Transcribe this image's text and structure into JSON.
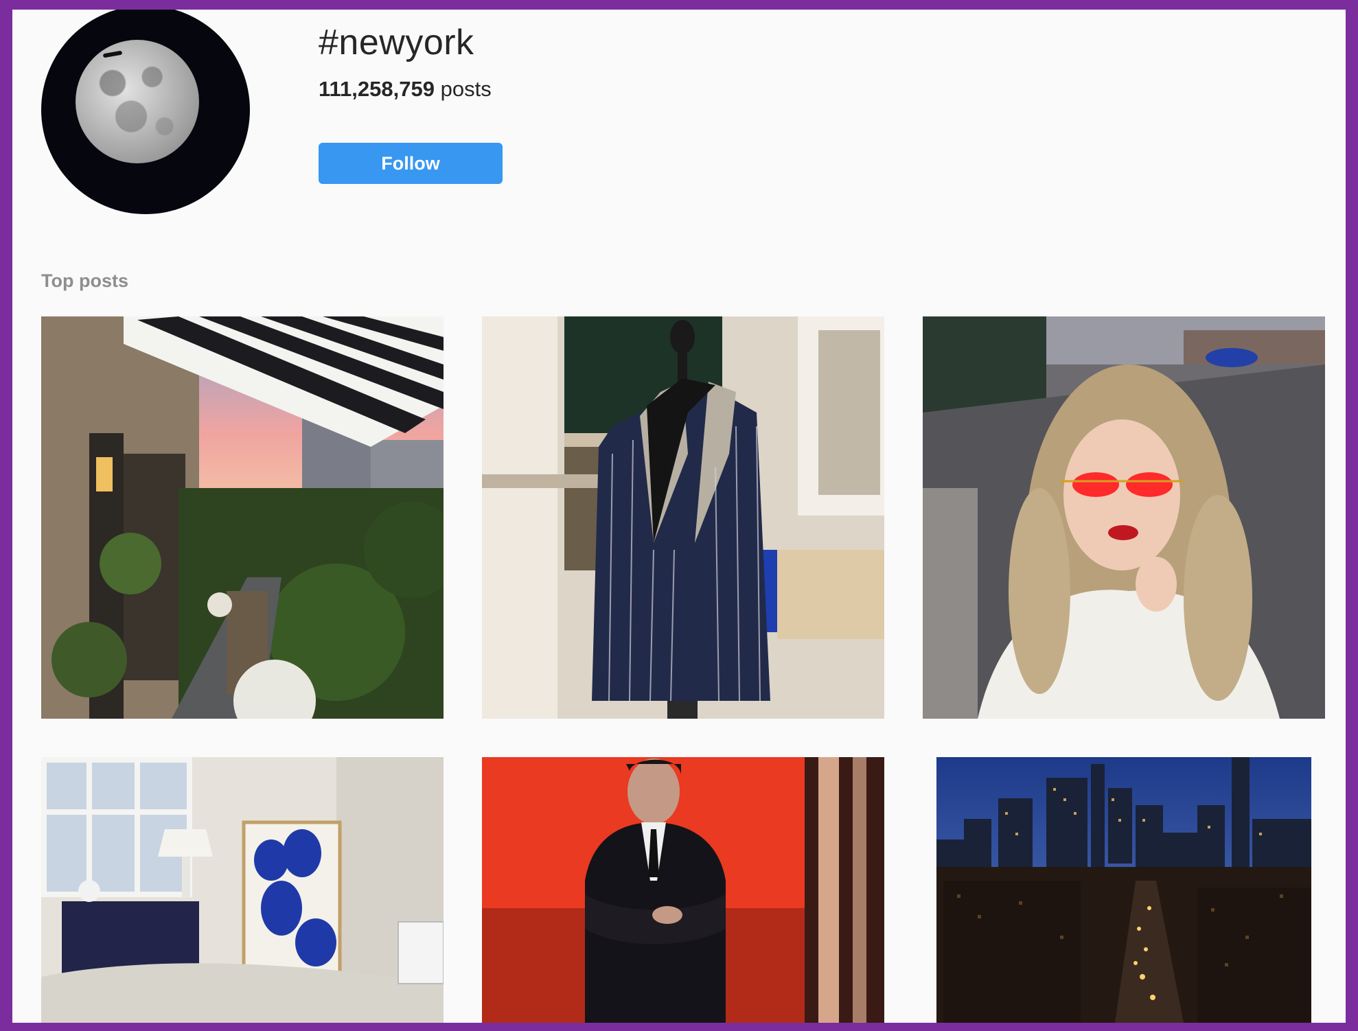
{
  "hashtag": {
    "title": "#newyork",
    "post_count": "111,258,759",
    "post_count_label": "posts",
    "follow_label": "Follow"
  },
  "sections": {
    "top_posts_label": "Top posts"
  },
  "colors": {
    "follow_button": "#3897f0",
    "page_background": "#fafafa",
    "outer_border": "#7b2d9e"
  },
  "posts": [
    {
      "subject": "rooftop terrace with striped awning at sunset"
    },
    {
      "subject": "navy pinstripe suit jacket on tailor mannequin"
    },
    {
      "subject": "woman with red round sunglasses on city street"
    },
    {
      "subject": "bedroom with blue abstract art print"
    },
    {
      "subject": "man in black suit against red background"
    },
    {
      "subject": "night skyline of lower Manhattan"
    }
  ]
}
